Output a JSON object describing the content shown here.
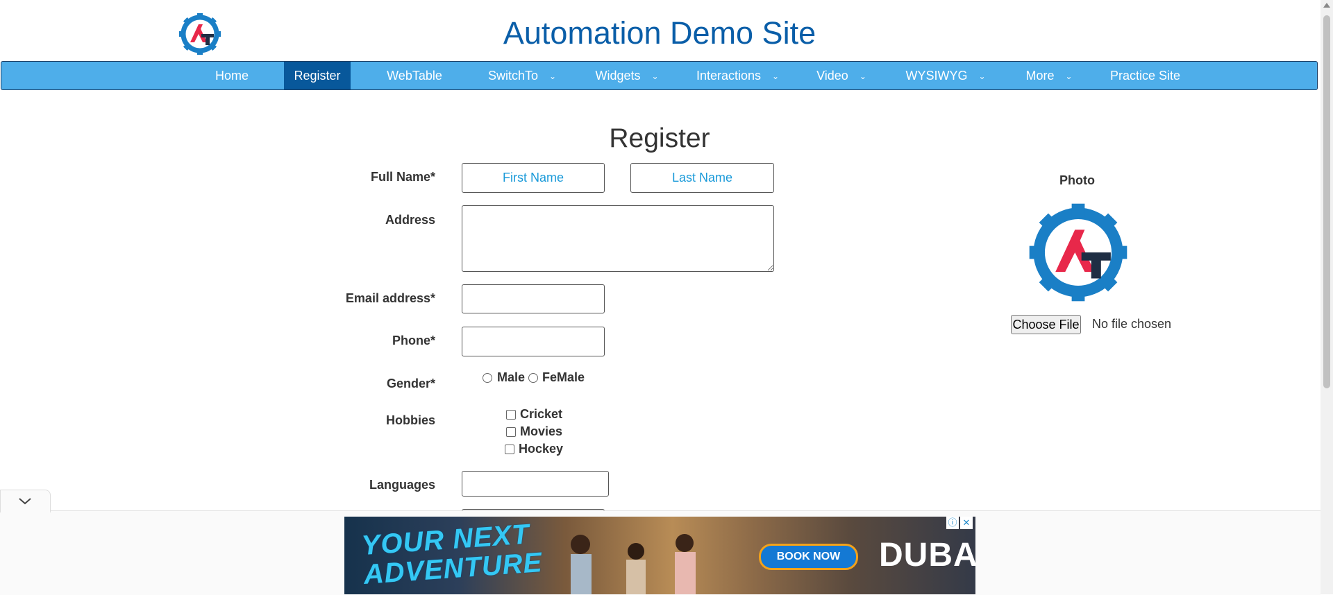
{
  "header": {
    "title": "Automation Demo Site",
    "logo_text": "AT"
  },
  "nav": {
    "items": [
      {
        "label": "Home",
        "dropdown": false
      },
      {
        "label": "Register",
        "dropdown": false,
        "active": true
      },
      {
        "label": "WebTable",
        "dropdown": false
      },
      {
        "label": "SwitchTo",
        "dropdown": true
      },
      {
        "label": "Widgets",
        "dropdown": true
      },
      {
        "label": "Interactions",
        "dropdown": true
      },
      {
        "label": "Video",
        "dropdown": true
      },
      {
        "label": "WYSIWYG",
        "dropdown": true
      },
      {
        "label": "More",
        "dropdown": true
      },
      {
        "label": "Practice Site",
        "dropdown": false
      }
    ],
    "caret": "⌄"
  },
  "form": {
    "heading": "Register",
    "full_name_label": "Full Name*",
    "first_name_placeholder": "First Name",
    "last_name_placeholder": "Last Name",
    "address_label": "Address",
    "email_label": "Email address*",
    "phone_label": "Phone*",
    "gender_label": "Gender*",
    "gender_options": [
      "Male",
      "FeMale"
    ],
    "hobbies_label": "Hobbies",
    "hobbies_options": [
      "Cricket",
      "Movies",
      "Hockey"
    ],
    "languages_label": "Languages"
  },
  "photo": {
    "label": "Photo",
    "choose_file_label": "Choose File",
    "file_status": "No file chosen"
  },
  "ad": {
    "headline": "YOUR NEXT ADVENTURE",
    "cta": "BOOK NOW",
    "brand": "DUBAI",
    "info_icon": "ⓘ",
    "close_icon": "✕"
  },
  "colors": {
    "title_blue": "#0a5ea8",
    "nav_bg": "#4eaeea",
    "nav_active": "#08589b",
    "placeholder_blue": "#1a9ad9"
  }
}
